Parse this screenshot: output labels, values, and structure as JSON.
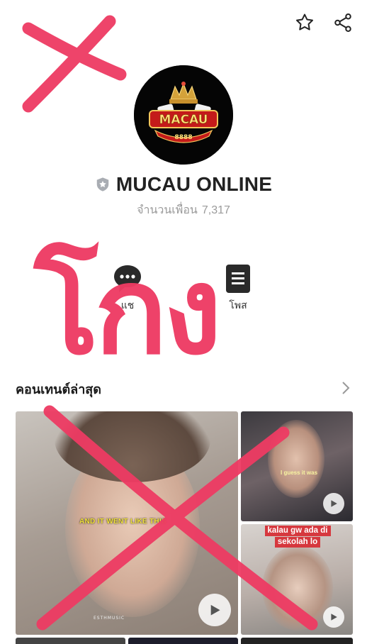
{
  "header": {
    "favorite_icon": "star-icon",
    "share_icon": "share-icon"
  },
  "profile": {
    "logo_text": "MACAU",
    "logo_number": "8888",
    "name": "MUCAU ONLINE",
    "friends_label": "จำนวนเพื่อน",
    "friends_count": "7,317"
  },
  "actions": {
    "chat_label": "แช",
    "posts_label": "โพส"
  },
  "content": {
    "section_title": "คอนเทนต์ล่าสุด",
    "tiles": [
      {
        "caption": "AND IT WENT LIKE THIS",
        "watermark": "ESTHMUSIC"
      },
      {
        "caption": "I guess it was"
      },
      {
        "caption_lines": [
          "kalau gw ada di",
          "sekolah lo"
        ]
      }
    ]
  },
  "overlay": {
    "scrawl_text": "โกง",
    "color": "#ee3b63"
  }
}
